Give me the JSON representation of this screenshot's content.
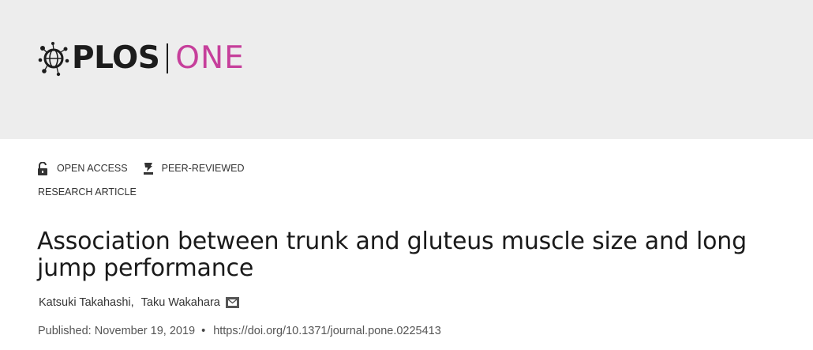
{
  "header": {
    "logo_plos": "PLOS",
    "logo_one": "ONE",
    "brand_color": "#c63f9b"
  },
  "badges": {
    "open_access": "OPEN ACCESS",
    "peer_reviewed": "PEER-REVIEWED",
    "open_access_icon": "unlocked-padlock-icon",
    "peer_reviewed_icon": "peer-review-icon"
  },
  "article": {
    "type": "RESEARCH ARTICLE",
    "title": "Association between trunk and gluteus muscle size and long jump performance",
    "authors": [
      {
        "name": "Katsuki Takahashi",
        "separator": ","
      },
      {
        "name": "Taku Wakahara",
        "separator": ""
      }
    ],
    "email_icon": "envelope-icon",
    "published": "Published: November 19, 2019",
    "bullet": "•",
    "doi": "https://doi.org/10.1371/journal.pone.0225413"
  }
}
